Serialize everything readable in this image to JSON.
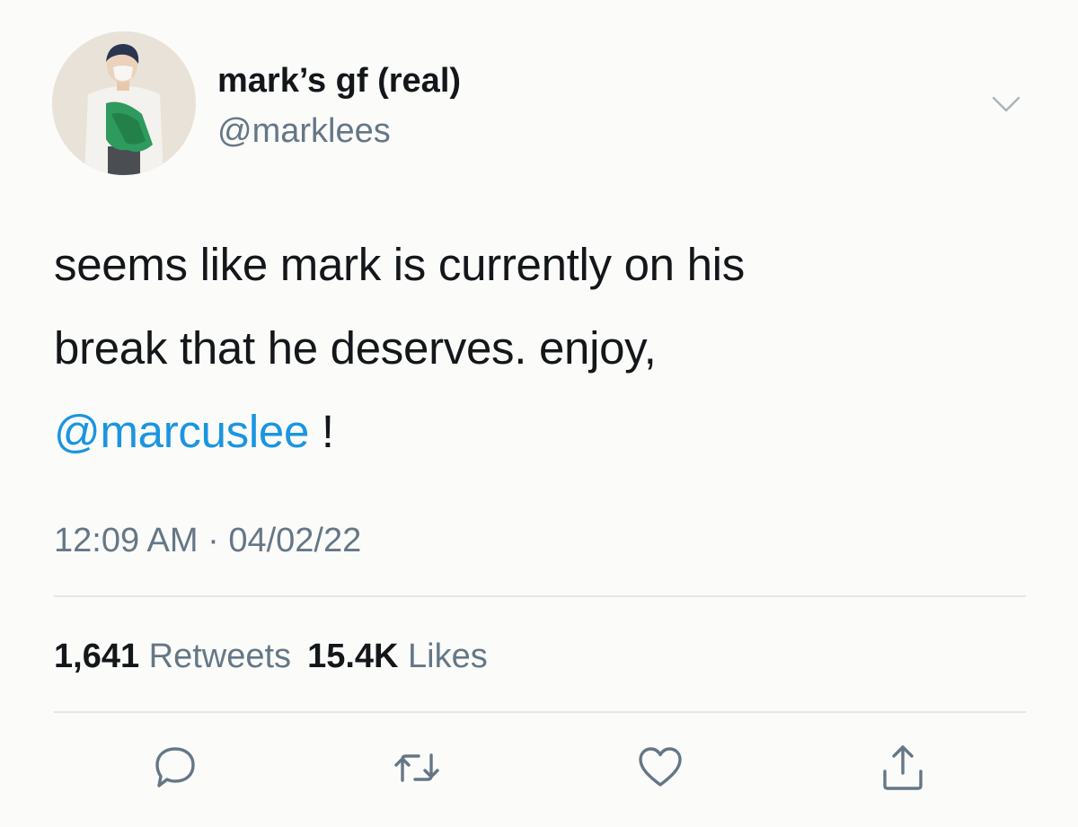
{
  "user": {
    "display_name": "mark’s gf (real)",
    "handle": "@marklees",
    "avatar": "avatar-photo"
  },
  "tweet": {
    "text_line1": "seems like mark is currently on his",
    "text_line2": "break that he deserves. enjoy,",
    "mention": "@marcuslee",
    "mention_suffix": " !",
    "time": "12:09 AM",
    "separator": "·",
    "date": "04/02/22"
  },
  "stats": {
    "retweets_count": "1,641",
    "retweets_label": "Retweets",
    "likes_count": "15.4K",
    "likes_label": "Likes"
  },
  "actions": [
    {
      "name": "reply",
      "icon": "speech-bubble-icon"
    },
    {
      "name": "retweet",
      "icon": "retweet-icon"
    },
    {
      "name": "like",
      "icon": "heart-icon"
    },
    {
      "name": "share",
      "icon": "share-icon"
    }
  ],
  "colors": {
    "background": "#fbfbfa",
    "text": "#14171a",
    "secondary": "#657786",
    "link": "#1b95e0",
    "divider": "#e3e6e8"
  }
}
